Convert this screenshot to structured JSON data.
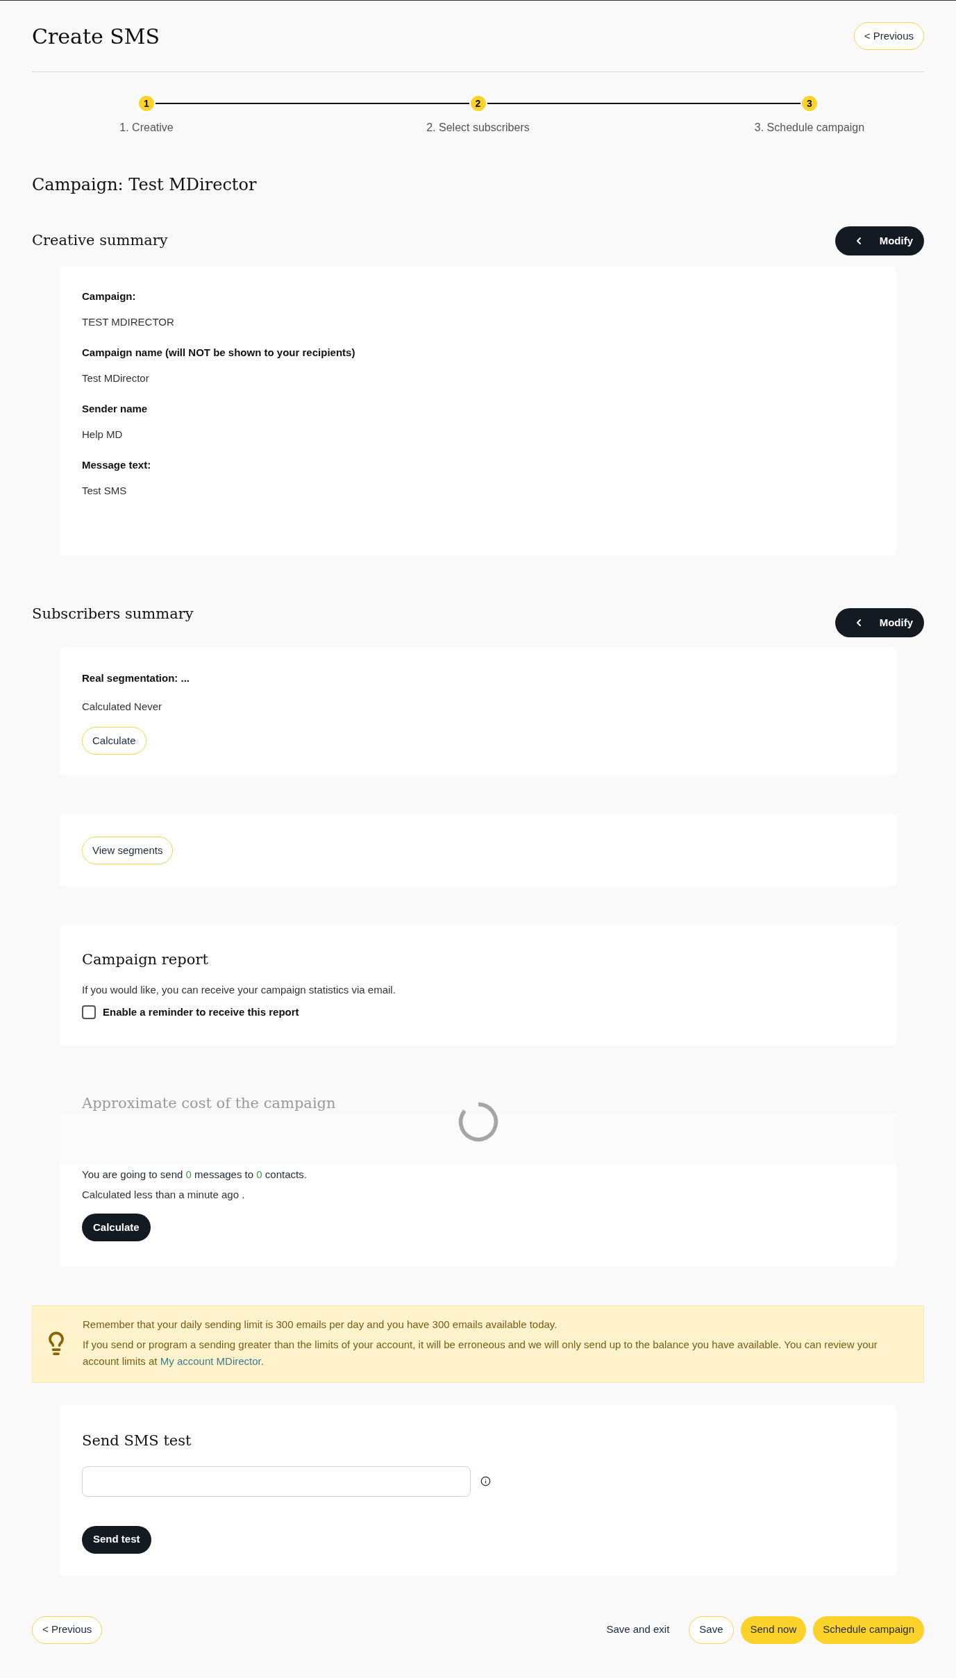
{
  "header": {
    "title": "Create SMS",
    "previous_button": "< Previous"
  },
  "steps": [
    {
      "number": "1",
      "label": "1. Creative"
    },
    {
      "number": "2",
      "label": "2. Select subscribers"
    },
    {
      "number": "3",
      "label": "3. Schedule campaign"
    }
  ],
  "campaign_title": "Campaign: Test MDirector",
  "creative_summary": {
    "title": "Creative summary",
    "modify_button": "Modify",
    "fields": [
      {
        "label": "Campaign:",
        "value": "TEST MDIRECTOR"
      },
      {
        "label": "Campaign name (will NOT be shown to your recipients)",
        "value": "Test MDirector"
      },
      {
        "label": "Sender name",
        "value": "Help MD"
      },
      {
        "label": "Message text:",
        "value": "Test SMS"
      }
    ]
  },
  "subscribers_summary": {
    "title": "Subscribers summary",
    "modify_button": "Modify",
    "segmentation_label": "Real segmentation: ...",
    "calculated": "Calculated Never",
    "calculate_button": "Calculate"
  },
  "segments": {
    "view_button": "View segments"
  },
  "campaign_report": {
    "title": "Campaign report",
    "description": "If you would like, you can receive your campaign statistics via email.",
    "reminder": {
      "label": "Enable a reminder to receive this report",
      "checked": false
    }
  },
  "cost": {
    "title": "Approximate cost of the campaign",
    "loading": true,
    "summary": [
      {
        "kind": "text",
        "text": "You are going to send "
      },
      {
        "kind": "count",
        "text": "0"
      },
      {
        "kind": "text",
        "text": " messages to "
      },
      {
        "kind": "count",
        "text": "0"
      },
      {
        "kind": "text",
        "text": " contacts."
      }
    ],
    "calculated": "Calculated less than a minute ago .",
    "calculate_button": "Calculate"
  },
  "notice": {
    "lines": [
      "Remember that your daily sending limit is 300 emails per day and you have 300 emails available today.",
      "If you send or program a sending greater than the limits of your account, it will be erroneous and we will only send up to the balance you have available. You can review your account limits at "
    ],
    "link": "My account MDirector",
    "link_tail": "."
  },
  "sms_test": {
    "title": "Send SMS test",
    "send_button": "Send test"
  },
  "footer": {
    "previous_button": "< Previous",
    "save_exit": "Save and exit",
    "save": "Save",
    "send_now": "Send now",
    "schedule": "Schedule campaign"
  }
}
